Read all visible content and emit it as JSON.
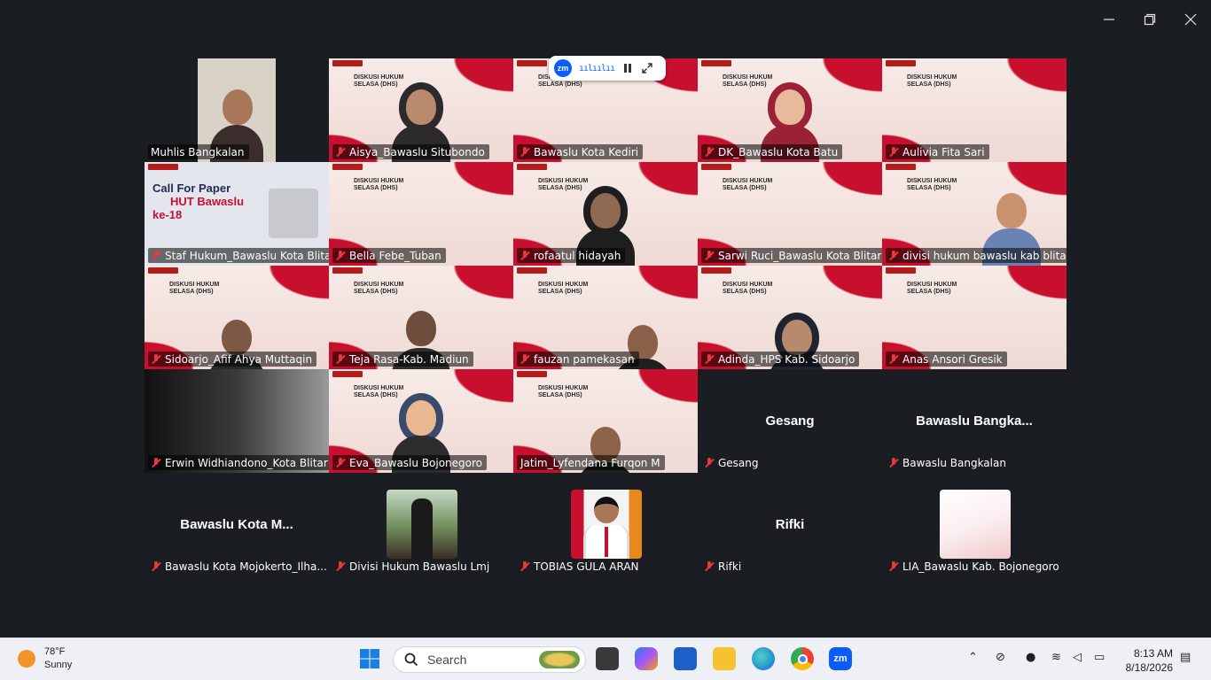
{
  "window": {
    "minimize": "minimize",
    "restore": "restore",
    "close": "close"
  },
  "zoom_bar": {
    "logo": "zm",
    "audio_indicator": "ıılıılıı"
  },
  "tiles": [
    {
      "name": "Muhlis Bangkalan"
    },
    {
      "name": "Aisya_Bawaslu Situbondo"
    },
    {
      "name": "Bawaslu Kota Kediri"
    },
    {
      "name": "DK_Bawaslu Kota Batu"
    },
    {
      "name": "Aulivia Fita Sari"
    },
    {
      "name": "Staf Hukum_Bawaslu Kota Blitar",
      "slide_lines": [
        "Call For Paper",
        "HUT Bawaslu",
        "ke-18"
      ]
    },
    {
      "name": "Bella Febe_Tuban"
    },
    {
      "name": "rofaatul hidayah"
    },
    {
      "name": "Sarwi Ruci_Bawaslu Kota Blitar"
    },
    {
      "name": "divisi hukum bawaslu kab blitar"
    },
    {
      "name": "Sidoarjo_Afif Ahya Muttaqin"
    },
    {
      "name": "Teja Rasa-Kab. Madiun"
    },
    {
      "name": "fauzan pamekasan"
    },
    {
      "name": "Adinda_HPS Kab. Sidoarjo"
    },
    {
      "name": "Anas Ansori Gresik"
    },
    {
      "name": "Erwin Widhiandono_Kota Blitar"
    },
    {
      "name": "Eva_Bawaslu Bojonegoro"
    },
    {
      "name": "Jatim_Lyfendana Furqon M"
    },
    {
      "name": "Gesang",
      "center": "Gesang"
    },
    {
      "name": "Bawaslu Bangkalan",
      "center": "Bawaslu  Bangka..."
    },
    {
      "name": "Bawaslu Kota Mojokerto_Ilha...",
      "center": "Bawaslu  Kota  M..."
    },
    {
      "name": "Divisi Hukum Bawaslu Lmj"
    },
    {
      "name": "TOBIAS GULA ARAN"
    },
    {
      "name": "Rifki",
      "center": "Rifki"
    },
    {
      "name": "LIA_Bawaslu Kab. Bojonegoro"
    }
  ],
  "slide": {
    "title": "DISKUSI HUKUM SELASA (DHS)"
  },
  "taskbar": {
    "weather_temp": "78°F",
    "weather_desc": "Sunny",
    "search_placeholder": "Search",
    "time": "8:13 AM",
    "date": "8/18/2026",
    "zoom_label": "zm"
  }
}
